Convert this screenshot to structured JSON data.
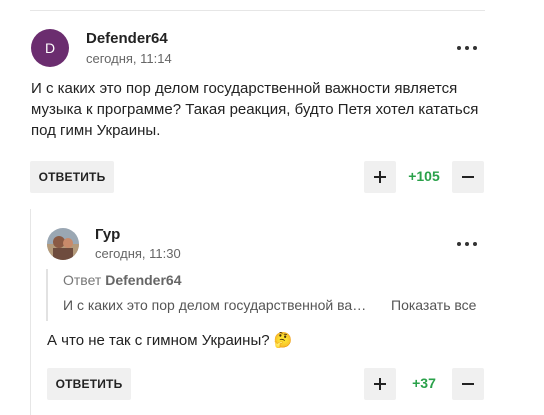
{
  "comments": [
    {
      "avatar_initial": "D",
      "author": "Defender64",
      "time": "сегодня, 11:14",
      "text": "И с каких это пор делом государственной важности является музыка к программе? Такая реакция, будто Петя хотел кататься под гимн Украины.",
      "reply_label": "ОТВЕТИТЬ",
      "score": "+105",
      "more_icon": "more-dots-icon"
    },
    {
      "author": "Гур",
      "time": "сегодня, 11:30",
      "quote": {
        "prefix": "Ответ",
        "author": "Defender64",
        "text": "И с каких это пор делом государственной важности является музыка к программе?",
        "show_all": "Показать все"
      },
      "text": "А что не так с гимном Украины? 🤔",
      "reply_label": "ОТВЕТИТЬ",
      "score": "+37",
      "more_icon": "more-dots-icon"
    }
  ],
  "colors": {
    "avatar_bg": "#6b2d6f",
    "score_positive": "#2aa14a",
    "button_bg": "#f0f0f0"
  }
}
